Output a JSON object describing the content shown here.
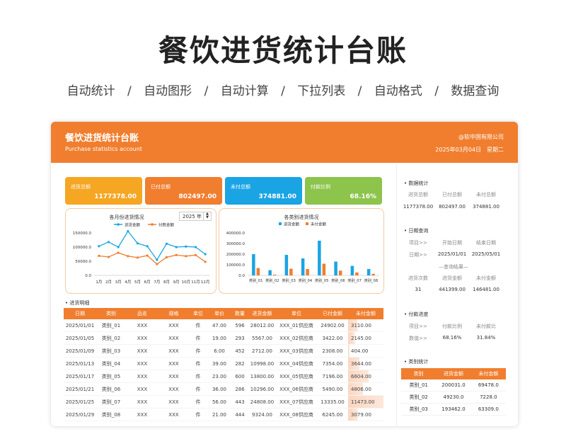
{
  "hero": {
    "title": "餐饮进货统计台账",
    "features": [
      "自动统计",
      "/",
      "自动图形",
      "/",
      "自动计算",
      "/",
      "下拉列表",
      "/",
      "自动格式",
      "/",
      "数据查询"
    ]
  },
  "header": {
    "title": "餐饮进货统计台账",
    "subtitle": "Purchase statistics account",
    "company": "@软中国有限公司",
    "date": "2025年03月04日",
    "weekday": "星期二"
  },
  "colors": {
    "accent": "#f07e2e",
    "card1": "#f5a623",
    "card2": "#f07e2e",
    "card3": "#1aa4e4",
    "card4": "#8cc44c",
    "series_purchase": "#1aa4e4",
    "series_paid": "#f07e2e"
  },
  "cards": [
    {
      "label": "进货总额",
      "value": "1177378.00"
    },
    {
      "label": "已付总额",
      "value": "802497.00"
    },
    {
      "label": "未付总额",
      "value": "374881.00"
    },
    {
      "label": "付款比例",
      "value": "68.16%"
    }
  ],
  "year_select": {
    "value": "2025 年"
  },
  "chart_data": [
    {
      "type": "line",
      "title": "各月份进货情况",
      "categories": [
        "1月",
        "2月",
        "3月",
        "4月",
        "5月",
        "6月",
        "7月",
        "8月",
        "9月",
        "10月",
        "11月",
        "12月"
      ],
      "series": [
        {
          "name": "进货金额",
          "values": [
            103000,
            118000,
            100000,
            156000,
            113000,
            103000,
            55000,
            112000,
            100000,
            102000,
            100000,
            75000
          ]
        },
        {
          "name": "付款金额",
          "values": [
            69000,
            65000,
            80000,
            68000,
            63000,
            70000,
            40000,
            64000,
            72000,
            68000,
            72000,
            48000
          ]
        }
      ],
      "ylim": [
        0,
        150000
      ],
      "yticks": [
        "150000.0",
        "100000.0",
        "50000.0",
        "0.0"
      ],
      "legend": "top"
    },
    {
      "type": "bar",
      "title": "各类别进货情况",
      "categories": [
        "类别_01",
        "类别_02",
        "类别_03",
        "类别_04",
        "类别_05",
        "类别_06",
        "类别_07",
        "类别_08"
      ],
      "series": [
        {
          "name": "进货金额",
          "values": [
            200031,
            49230,
            193462,
            160000,
            327000,
            130000,
            90000,
            60000
          ]
        },
        {
          "name": "未付金额",
          "values": [
            69478,
            7228,
            63309,
            60000,
            110000,
            45000,
            28000,
            15000
          ]
        }
      ],
      "ylim": [
        0,
        400000
      ],
      "yticks": [
        "400000.0",
        "300000.0",
        "200000.0",
        "100000.0",
        "0.0"
      ],
      "legend": "top"
    }
  ],
  "detail": {
    "title": "• 进货明细",
    "columns": [
      "日期",
      "类别",
      "品名",
      "规格",
      "单位",
      "单价",
      "数量",
      "进货金额",
      "单位",
      "已付金额",
      "未付金额"
    ],
    "rows": [
      [
        "2025/01/01",
        "类别_01",
        "XXX",
        "XXX",
        "件",
        "47.00",
        "596",
        "28012.00",
        "XXX_01供应商",
        "24902.00",
        "3110.00"
      ],
      [
        "2025/01/05",
        "类别_02",
        "XXX",
        "XXX",
        "件",
        "19.00",
        "293",
        "5567.00",
        "XXX_02供应商",
        "3422.00",
        "2145.00"
      ],
      [
        "2025/01/09",
        "类别_03",
        "XXX",
        "XXX",
        "件",
        "6.00",
        "452",
        "2712.00",
        "XXX_03供应商",
        "2308.00",
        "404.00"
      ],
      [
        "2025/01/13",
        "类别_04",
        "XXX",
        "XXX",
        "件",
        "39.00",
        "282",
        "10998.00",
        "XXX_04供应商",
        "7354.00",
        "3644.00"
      ],
      [
        "2025/01/17",
        "类别_05",
        "XXX",
        "XXX",
        "件",
        "23.00",
        "600",
        "13800.00",
        "XXX_05供应商",
        "7196.00",
        "6604.00"
      ],
      [
        "2025/01/21",
        "类别_06",
        "XXX",
        "XXX",
        "件",
        "36.00",
        "286",
        "10296.00",
        "XXX_06供应商",
        "5490.00",
        "4806.00"
      ],
      [
        "2025/01/25",
        "类别_07",
        "XXX",
        "XXX",
        "件",
        "56.00",
        "443",
        "24808.00",
        "XXX_07供应商",
        "13335.00",
        "11473.00"
      ],
      [
        "2025/01/29",
        "类别_08",
        "XXX",
        "XXX",
        "件",
        "21.00",
        "444",
        "9324.00",
        "XXX_08供应商",
        "6245.00",
        "3079.00"
      ]
    ]
  },
  "right": {
    "stats_title": "• 数据统计",
    "stats_headers": [
      "进货总额",
      "已付总额",
      "未付总额"
    ],
    "stats_values": [
      "1177378.00",
      "802497.00",
      "374881.00"
    ],
    "query_title": "• 日期查询",
    "query_headers": [
      "项目>>",
      "开始日期",
      "结束日期"
    ],
    "query_row": [
      "日期>>",
      "2025/01/01",
      "2025/05/01"
    ],
    "query_result_title": "—查询结果—",
    "query_result_headers": [
      "进货次数",
      "进货金额",
      "未付金额"
    ],
    "query_result_values": [
      "31",
      "441399.00",
      "146481.00"
    ],
    "pay_title": "• 付款进度",
    "pay_headers": [
      "项目>>",
      "付款比例",
      "未付款比"
    ],
    "pay_row": [
      "数值>>",
      "68.16%",
      "31.84%"
    ],
    "cat_title": "• 类别统计",
    "cat_columns": [
      "类别",
      "进货金额",
      "未付金额"
    ],
    "cat_rows": [
      [
        "类别_01",
        "200031.0",
        "69478.0"
      ],
      [
        "类别_02",
        "49230.0",
        "7228.0"
      ],
      [
        "类别_03",
        "193462.0",
        "63309.0"
      ]
    ]
  }
}
